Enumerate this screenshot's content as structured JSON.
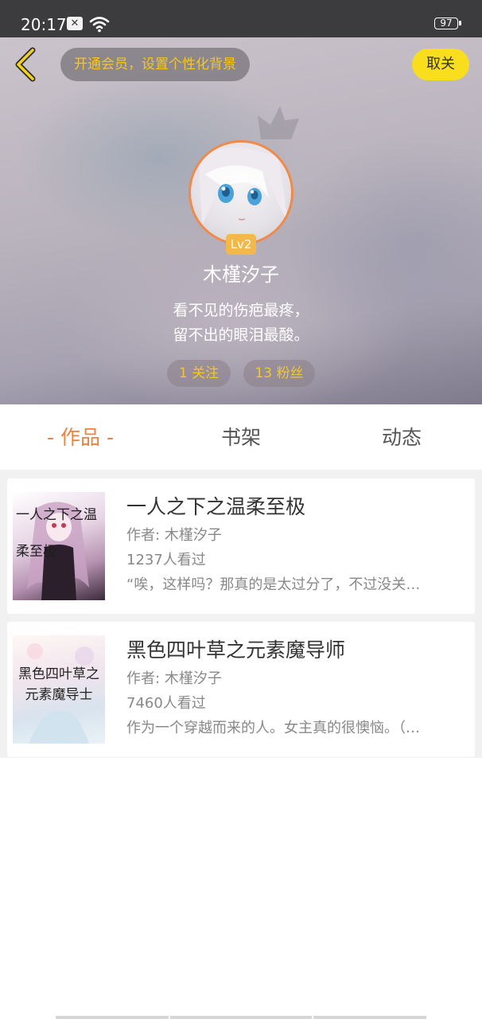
{
  "status_bar": {
    "time": "20:17",
    "battery": "97",
    "icons": [
      "notification-icon",
      "wifi-icon",
      "battery-icon"
    ]
  },
  "header": {
    "back_icon": "chevron-left-icon",
    "vip_banner": "开通会员，设置个性化背景",
    "unfollow_label": "取关",
    "level": "Lv2",
    "user_name": "木槿汐子",
    "bio_line_1": "看不见的伤疤最疼，",
    "bio_line_2": "留不出的眼泪最酸。",
    "following": "1 关注",
    "followers": "13 粉丝"
  },
  "tabs": {
    "works": "- 作品 -",
    "shelf": "书架",
    "feed": "动态"
  },
  "books": [
    {
      "cover_text": "一人之下之温柔至极",
      "title": "一人之下之温柔至极",
      "author": "作者: 木槿汐子",
      "views": "1237人看过",
      "excerpt": "“唉，这样吗？那真的是太过分了，不过没关…"
    },
    {
      "cover_text": "黑色四叶草之元素魔导士",
      "title": "黑色四叶草之元素魔导师",
      "author": "作者: 木槿汐子",
      "views": "7460人看过",
      "excerpt": "作为一个穿越而来的人。女主真的很懊恼。（…"
    }
  ],
  "colors": {
    "accent": "#f0803c",
    "vip_text": "#f4c62a",
    "unfollow_bg": "#f8de1c",
    "level_badge": "#f2b94a"
  }
}
